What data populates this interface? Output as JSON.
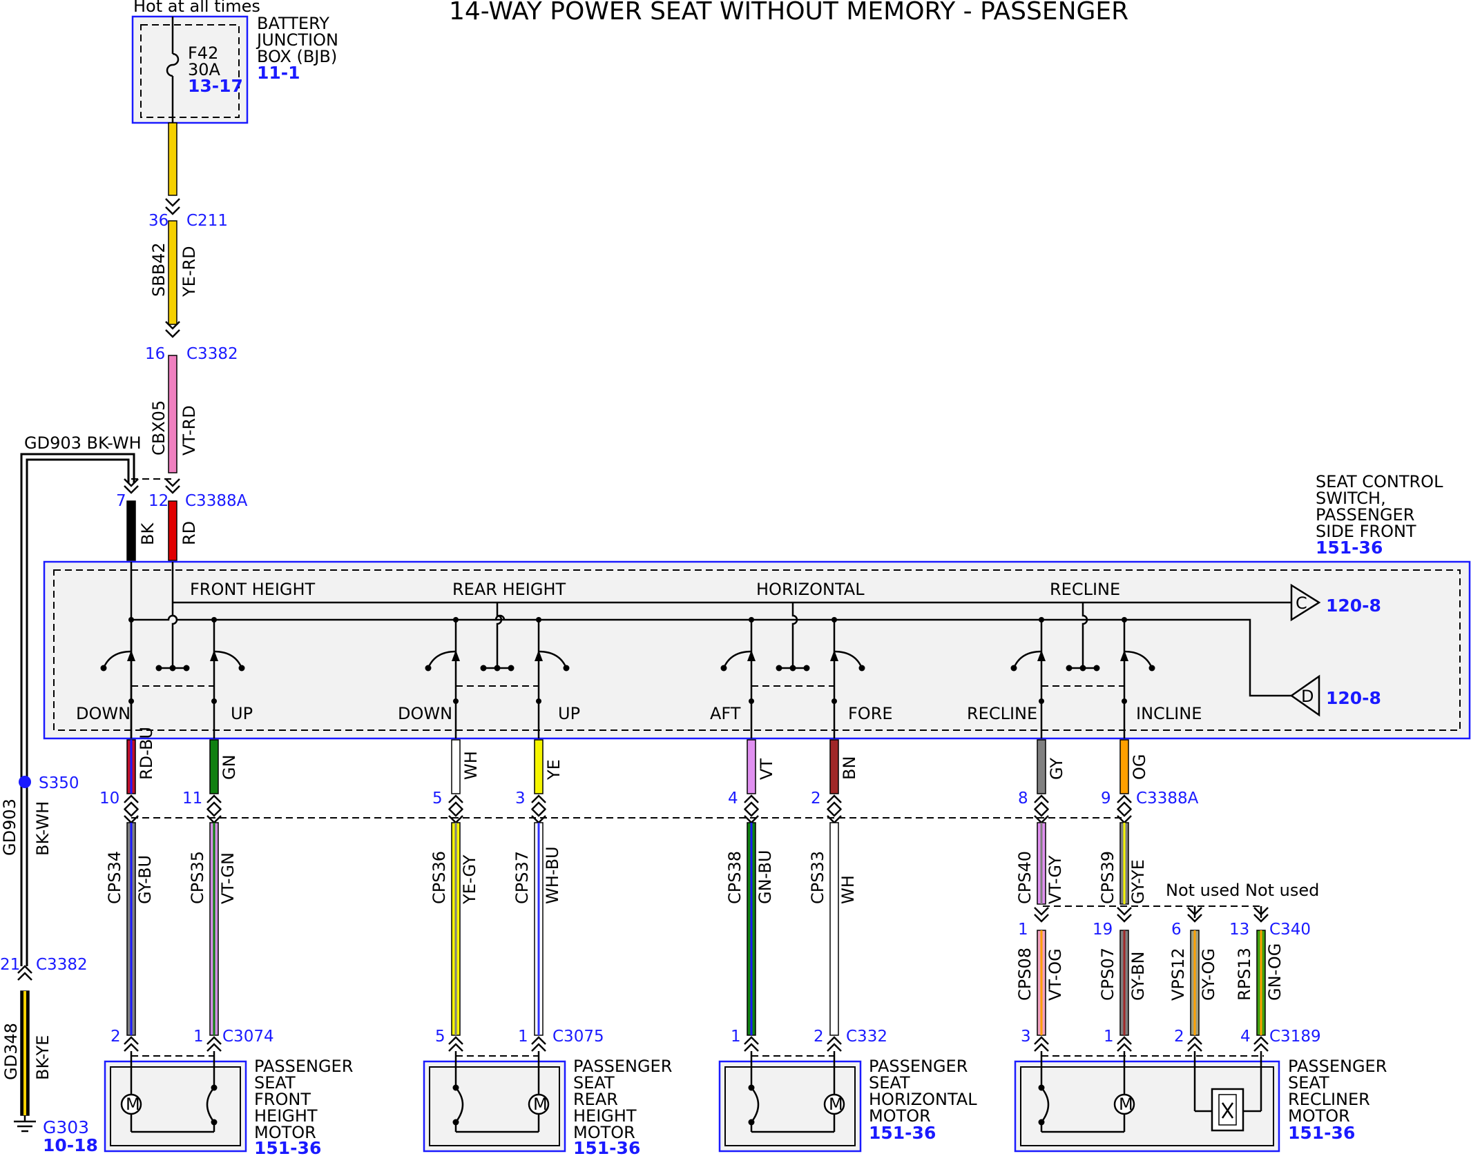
{
  "title": "14-WAY POWER SEAT WITHOUT MEMORY - PASSENGER",
  "hot_label": "Hot at all times",
  "bjb": {
    "lines": [
      "BATTERY",
      "JUNCTION",
      "BOX (BJB)"
    ],
    "ref": "11-1",
    "fuse": "F42",
    "amp": "30A",
    "fuse_ref": "13-17"
  },
  "scs": {
    "lines": [
      "SEAT CONTROL",
      "SWITCH,",
      "PASSENGER",
      "SIDE FRONT"
    ],
    "ref": "151-36"
  },
  "sections": [
    "FRONT HEIGHT",
    "REAR HEIGHT",
    "HORIZONTAL",
    "RECLINE"
  ],
  "positions": [
    "DOWN",
    "UP",
    "DOWN",
    "UP",
    "AFT",
    "FORE",
    "RECLINE",
    "INCLINE"
  ],
  "connectors": {
    "c211": "C211",
    "c3382": "C3382",
    "c3388a": "C3388A",
    "c3074": "C3074",
    "c3075": "C3075",
    "c332": "C332",
    "c340": "C340",
    "c3189": "C3189"
  },
  "pins": {
    "c211_pin": "36",
    "c3382_pin": "16",
    "c3388a_bk": "7",
    "c3388a_rd": "12",
    "c3382_gnd": "21",
    "sw": [
      "10",
      "11",
      "5",
      "3",
      "4",
      "2",
      "8",
      "9"
    ],
    "motor": [
      "2",
      "1",
      "5",
      "1",
      "1",
      "2",
      "3",
      "1",
      "2",
      "4"
    ],
    "c340": [
      "1",
      "19",
      "6",
      "13"
    ]
  },
  "wires": {
    "sbb42": {
      "circuit": "SBB42",
      "color": "YE-RD"
    },
    "cbx05": {
      "circuit": "CBX05",
      "color": "VT-RD"
    },
    "bk": "BK",
    "rd": "RD",
    "gd903_top": "GD903 BK-WH",
    "gd903": {
      "circuit": "GD903",
      "color": "BK-WH"
    },
    "gd348": {
      "circuit": "GD348",
      "color": "BK-YE"
    },
    "sw": [
      "RD-BU",
      "GN",
      "WH",
      "YE",
      "VT",
      "BN",
      "GY",
      "OG"
    ],
    "lower": [
      {
        "circuit": "CPS34",
        "color": "GY-BU"
      },
      {
        "circuit": "CPS35",
        "color": "VT-GN"
      },
      {
        "circuit": "CPS36",
        "color": "YE-GY"
      },
      {
        "circuit": "CPS37",
        "color": "WH-BU"
      },
      {
        "circuit": "CPS38",
        "color": "GN-BU"
      },
      {
        "circuit": "CPS33",
        "color": "WH"
      },
      {
        "circuit": "CPS40",
        "color": "VT-GY"
      },
      {
        "circuit": "CPS39",
        "color": "GY-YE"
      }
    ],
    "recl": [
      {
        "circuit": "CPS08",
        "color": "VT-OG"
      },
      {
        "circuit": "CPS07",
        "color": "GY-BN"
      },
      {
        "circuit": "VPS12",
        "color": "GY-OG"
      },
      {
        "circuit": "RPS13",
        "color": "GN-OG"
      }
    ]
  },
  "splice": "S350",
  "ground": {
    "name": "G303",
    "ref": "10-18"
  },
  "offpage": [
    {
      "letter": "C",
      "ref": "120-8"
    },
    {
      "letter": "D",
      "ref": "120-8"
    }
  ],
  "not_used": "Not used",
  "motors": [
    {
      "lines": [
        "PASSENGER",
        "SEAT",
        "FRONT",
        "HEIGHT",
        "MOTOR"
      ],
      "ref": "151-36"
    },
    {
      "lines": [
        "PASSENGER",
        "SEAT",
        "REAR",
        "HEIGHT",
        "MOTOR"
      ],
      "ref": "151-36"
    },
    {
      "lines": [
        "PASSENGER",
        "SEAT",
        "HORIZONTAL",
        "MOTOR"
      ],
      "ref": "151-36"
    },
    {
      "lines": [
        "PASSENGER",
        "SEAT",
        "RECLINER",
        "MOTOR"
      ],
      "ref": "151-36"
    }
  ],
  "motor_symbol": "M",
  "colors": {
    "accent": "#1a1aff",
    "box_fill": "#f2f2f2"
  }
}
